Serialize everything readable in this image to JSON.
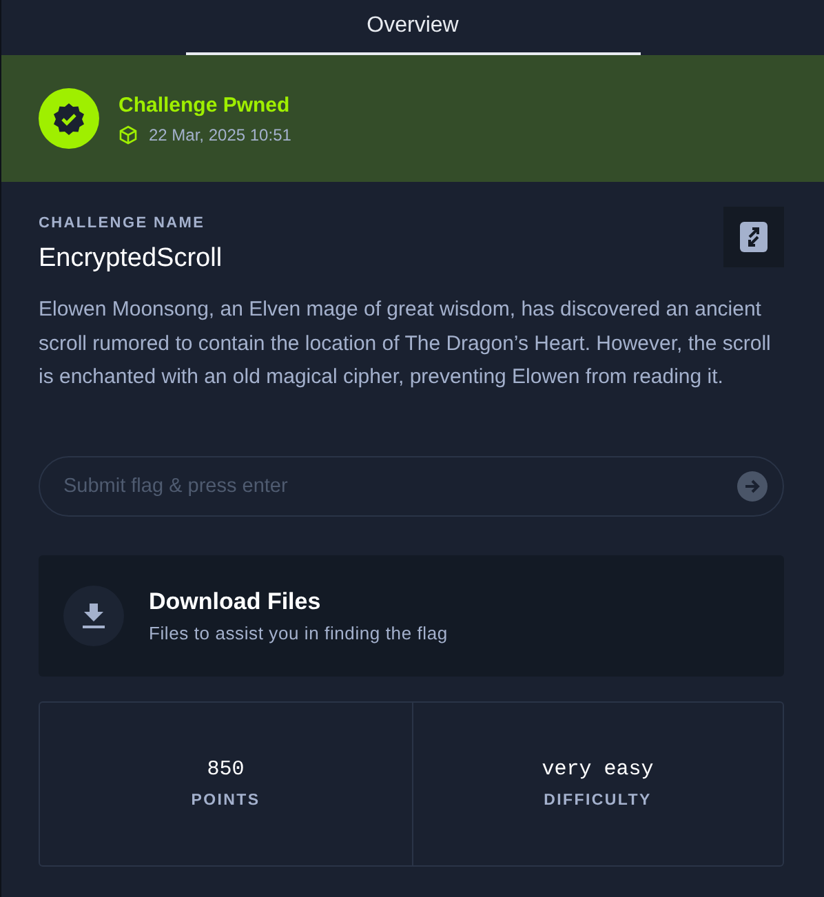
{
  "tabs": [
    {
      "label": "Overview",
      "selected": true
    }
  ],
  "banner": {
    "title": "Challenge Pwned",
    "date": "22 Mar, 2025 10:51"
  },
  "challenge": {
    "label": "CHALLENGE NAME",
    "name": "EncryptedScroll",
    "description": "Elowen Moonsong, an Elven mage of great wisdom, has discovered an ancient scroll rumored to contain the location of The Dragon’s Heart. However, the scroll is enchanted with an old magical cipher, preventing Elowen from reading it."
  },
  "flag_field": {
    "placeholder": "Submit flag & press enter"
  },
  "download": {
    "title": "Download Files",
    "subtitle": "Files to assist you in finding the flag"
  },
  "stats": [
    {
      "value": "850",
      "label": "POINTS"
    },
    {
      "value": "very easy",
      "label": "DIFFICULTY"
    }
  ]
}
